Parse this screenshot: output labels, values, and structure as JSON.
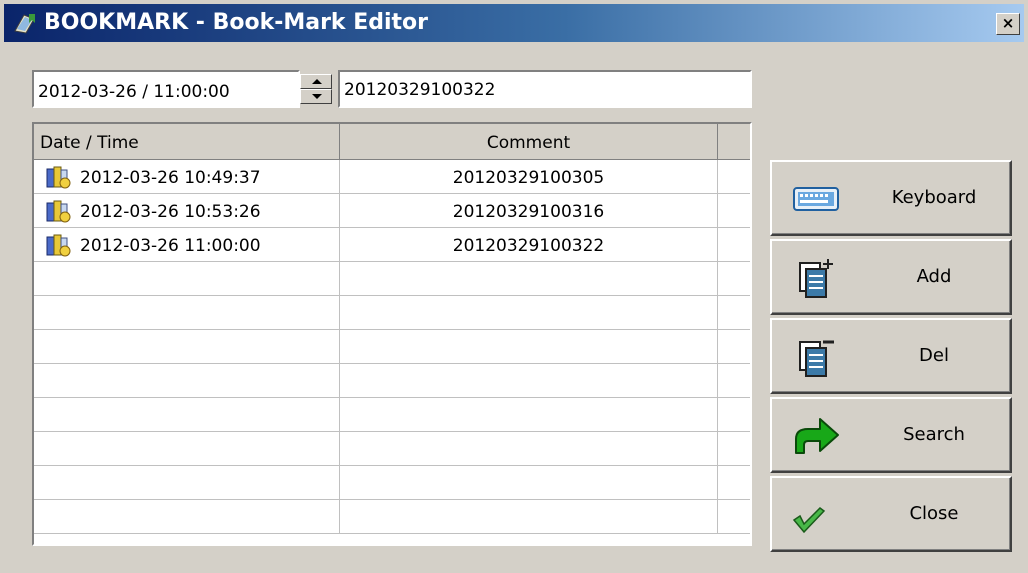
{
  "window": {
    "title": "BOOKMARK - Book-Mark Editor",
    "close_glyph": "×"
  },
  "inputs": {
    "datetime_value": "2012-03-26 / 11:00:00",
    "comment_value": "20120329100322"
  },
  "table": {
    "columns": [
      "Date / Time",
      "Comment"
    ],
    "rows": [
      {
        "datetime": "2012-03-26 10:49:37",
        "comment": "20120329100305"
      },
      {
        "datetime": "2012-03-26 10:53:26",
        "comment": "20120329100316"
      },
      {
        "datetime": "2012-03-26 11:00:00",
        "comment": "20120329100322"
      }
    ],
    "empty_rows": 8
  },
  "buttons": {
    "keyboard": {
      "label": "Keyboard",
      "icon": "keyboard-icon"
    },
    "add": {
      "label": "Add",
      "icon": "add-page-icon"
    },
    "del": {
      "label": "Del",
      "icon": "delete-page-icon"
    },
    "search": {
      "label": "Search",
      "icon": "arrow-right-icon"
    },
    "close": {
      "label": "Close",
      "icon": "checkmark-icon"
    }
  },
  "colors": {
    "titlebar_start": "#0a246a",
    "titlebar_end": "#a6caf0",
    "face": "#d4d0c8",
    "arrow_green": "#18a818"
  }
}
